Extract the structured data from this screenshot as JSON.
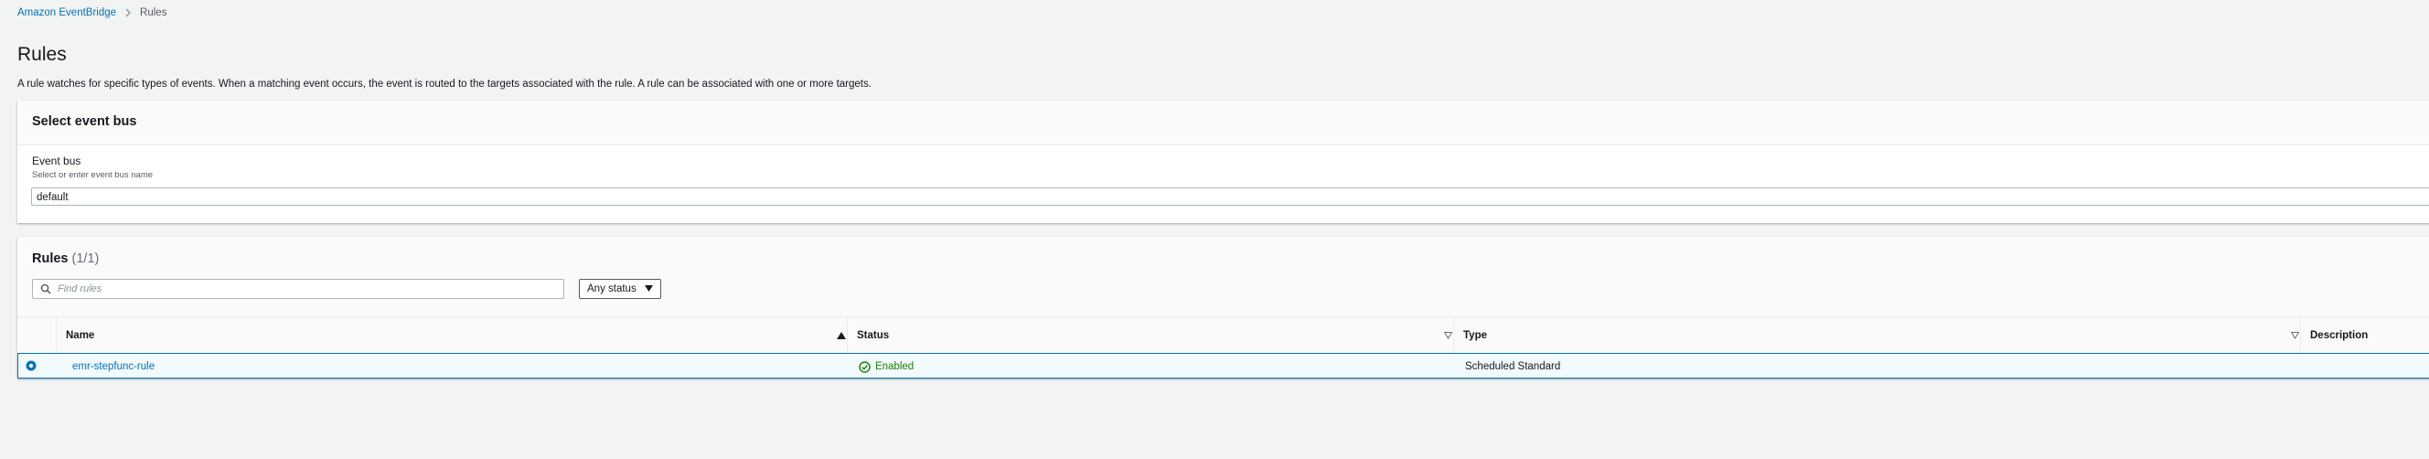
{
  "breadcrumb": {
    "root": "Amazon EventBridge",
    "current": "Rules"
  },
  "page": {
    "title": "Rules",
    "description": "A rule watches for specific types of events. When a matching event occurs, the event is routed to the targets associated with the rule. A rule can be associated with one or more targets."
  },
  "event_bus_panel": {
    "title": "Select event bus",
    "field_label": "Event bus",
    "field_hint": "Select or enter event bus name",
    "value": "default"
  },
  "rules_panel": {
    "title": "Rules",
    "count": "(1/1)",
    "search_placeholder": "Find rules",
    "status_filter": "Any status",
    "columns": {
      "name": "Name",
      "status": "Status",
      "type": "Type",
      "description": "Description"
    },
    "rows": [
      {
        "selected": true,
        "name": "emr-stepfunc-rule",
        "status": "Enabled",
        "type": "Scheduled Standard",
        "description": ""
      }
    ]
  },
  "colors": {
    "link": "#0073bb",
    "success": "#1d8102",
    "selected_row_bg": "#f1faff",
    "page_bg": "#f2f3f3"
  }
}
